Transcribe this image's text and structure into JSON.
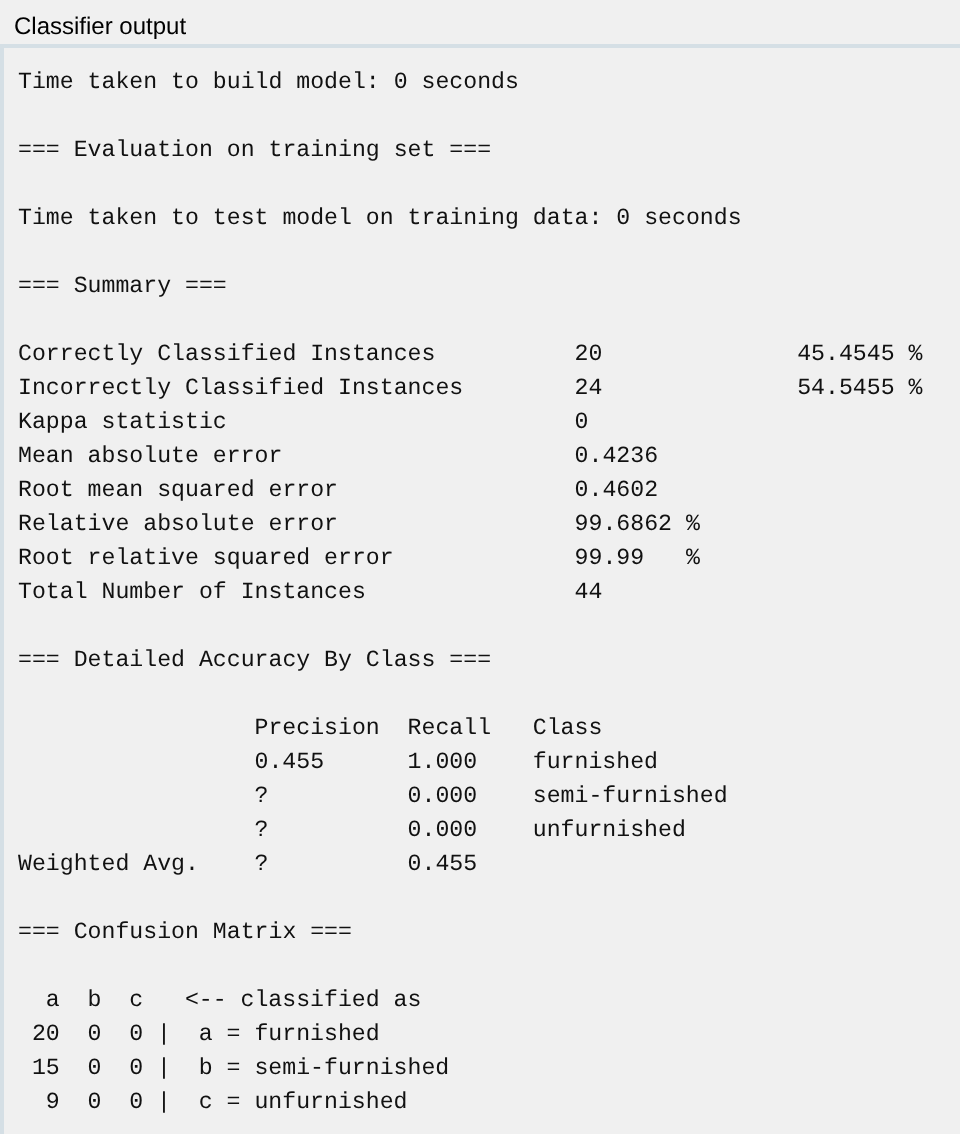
{
  "panel": {
    "title": "Classifier output"
  },
  "output": {
    "build_time": "Time taken to build model: 0 seconds",
    "evaluation_heading": "=== Evaluation on training set ===",
    "test_time": "Time taken to test model on training data: 0 seconds",
    "summary_heading": "=== Summary ===",
    "summary_rows": [
      {
        "label": "Correctly Classified Instances",
        "value": "20",
        "percent": "45.4545 %"
      },
      {
        "label": "Incorrectly Classified Instances",
        "value": "24",
        "percent": "54.5455 %"
      },
      {
        "label": "Kappa statistic",
        "value": "0"
      },
      {
        "label": "Mean absolute error",
        "value": "0.4236"
      },
      {
        "label": "Root mean squared error",
        "value": "0.4602"
      },
      {
        "label": "Relative absolute error",
        "value": "99.6862 %"
      },
      {
        "label": "Root relative squared error",
        "value": "99.99   %"
      },
      {
        "label": "Total Number of Instances",
        "value": "44"
      }
    ],
    "accuracy_heading": "=== Detailed Accuracy By Class ===",
    "accuracy_columns": [
      "Precision",
      "Recall",
      "Class"
    ],
    "accuracy_rows": [
      {
        "label": "",
        "cells": [
          "0.455",
          "1.000",
          "furnished"
        ]
      },
      {
        "label": "",
        "cells": [
          "?",
          "0.000",
          "semi-furnished"
        ]
      },
      {
        "label": "",
        "cells": [
          "?",
          "0.000",
          "unfurnished"
        ]
      },
      {
        "label": "Weighted Avg.",
        "cells": [
          "?",
          "0.455"
        ]
      }
    ],
    "matrix_heading": "=== Confusion Matrix ===",
    "matrix_columns": [
      "a",
      "b",
      "c"
    ],
    "matrix_caption": "<-- classified as",
    "matrix_rows": [
      {
        "counts": [
          "20",
          "0",
          "0"
        ],
        "separator": "|",
        "label": "a = furnished"
      },
      {
        "counts": [
          "15",
          "0",
          "0"
        ],
        "separator": "|",
        "label": "b = semi-furnished"
      },
      {
        "counts": [
          "9",
          "0",
          "0"
        ],
        "separator": "|",
        "label": "c = unfurnished"
      }
    ]
  }
}
